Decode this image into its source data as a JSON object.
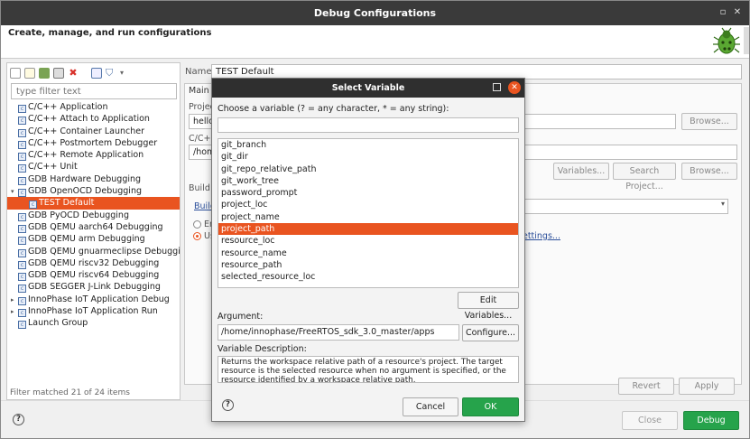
{
  "window": {
    "title": "Debug Configurations",
    "header": "Create, manage, and run configurations"
  },
  "left": {
    "filter_placeholder": "type filter text",
    "status": "Filter matched 21 of 24 items",
    "tree": [
      {
        "label": "C/C++ Application",
        "indent": 1,
        "selected": false
      },
      {
        "label": "C/C++ Attach to Application",
        "indent": 1,
        "selected": false
      },
      {
        "label": "C/C++ Container Launcher",
        "indent": 1,
        "selected": false
      },
      {
        "label": "C/C++ Postmortem Debugger",
        "indent": 1,
        "selected": false
      },
      {
        "label": "C/C++ Remote Application",
        "indent": 1,
        "selected": false
      },
      {
        "label": "C/C++ Unit",
        "indent": 1,
        "selected": false
      },
      {
        "label": "GDB Hardware Debugging",
        "indent": 1,
        "selected": false
      },
      {
        "label": "GDB OpenOCD Debugging",
        "indent": 1,
        "selected": false,
        "expanded": true
      },
      {
        "label": "TEST Default",
        "indent": 2,
        "selected": true
      },
      {
        "label": "GDB PyOCD Debugging",
        "indent": 1,
        "selected": false
      },
      {
        "label": "GDB QEMU aarch64 Debugging",
        "indent": 1,
        "selected": false
      },
      {
        "label": "GDB QEMU arm Debugging",
        "indent": 1,
        "selected": false
      },
      {
        "label": "GDB QEMU gnuarmeclipse Debugging (Dep",
        "indent": 1,
        "selected": false
      },
      {
        "label": "GDB QEMU riscv32 Debugging",
        "indent": 1,
        "selected": false
      },
      {
        "label": "GDB QEMU riscv64 Debugging",
        "indent": 1,
        "selected": false
      },
      {
        "label": "GDB SEGGER J-Link Debugging",
        "indent": 1,
        "selected": false
      },
      {
        "label": "InnoPhase IoT Application Debug",
        "indent": 0,
        "selected": false,
        "collapsed": true
      },
      {
        "label": "InnoPhase IoT Application Run",
        "indent": 0,
        "selected": false,
        "collapsed": true
      },
      {
        "label": "Launch Group",
        "indent": 1,
        "selected": false
      }
    ]
  },
  "right": {
    "name_label": "Name:",
    "name_value": "TEST Default",
    "tab_main": "Main",
    "project_label": "Project",
    "project_value": "hello_",
    "app_label": "C/C++ A",
    "app_value": "/home/",
    "build_label": "Build (",
    "build_link": "Build",
    "radio1": "En",
    "radio2": "Us",
    "build_text": "uild",
    "settings_link": "pace Settings...",
    "browse1": "Browse...",
    "variables_btn": "Variables...",
    "search_project_btn": "Search Project...",
    "browse2": "Browse...",
    "revert": "Revert",
    "apply": "Apply"
  },
  "bottom": {
    "close": "Close",
    "debug": "Debug"
  },
  "modal": {
    "title": "Select Variable",
    "choose_label": "Choose a variable (? = any character, * = any string):",
    "filter_value": "",
    "variables": [
      {
        "name": "git_branch",
        "selected": false
      },
      {
        "name": "git_dir",
        "selected": false
      },
      {
        "name": "git_repo_relative_path",
        "selected": false
      },
      {
        "name": "git_work_tree",
        "selected": false
      },
      {
        "name": "password_prompt",
        "selected": false
      },
      {
        "name": "project_loc",
        "selected": false
      },
      {
        "name": "project_name",
        "selected": false
      },
      {
        "name": "project_path",
        "selected": true
      },
      {
        "name": "resource_loc",
        "selected": false
      },
      {
        "name": "resource_name",
        "selected": false
      },
      {
        "name": "resource_path",
        "selected": false
      },
      {
        "name": "selected_resource_loc",
        "selected": false
      }
    ],
    "edit_variables": "Edit Variables...",
    "argument_label": "Argument:",
    "argument_value": "/home/innophase/FreeRTOS_sdk_3.0_master/apps",
    "configure": "Configure...",
    "description_label": "Variable Description:",
    "description": "Returns the workspace relative path of a resource's project. The target resource is the selected resource when no argument is specified, or the resource identified by a workspace relative path.",
    "cancel": "Cancel",
    "ok": "OK"
  },
  "colors": {
    "selection": "#e95420",
    "title_bar": "#3a3a3a",
    "ok_button": "#26a34b"
  }
}
